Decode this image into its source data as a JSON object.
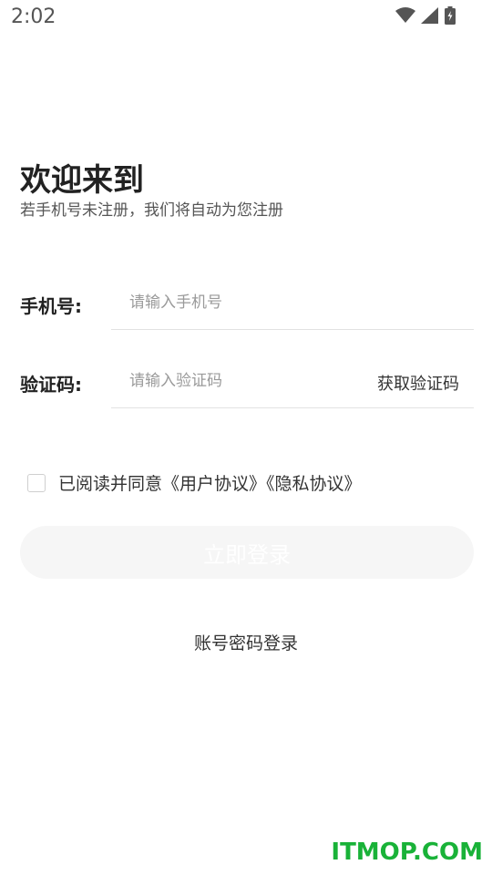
{
  "status_bar": {
    "time": "2:02"
  },
  "welcome": {
    "title": "欢迎来到",
    "subtitle": "若手机号未注册，我们将自动为您注册"
  },
  "phone": {
    "label": "手机号:",
    "placeholder": "请输入手机号",
    "value": ""
  },
  "code": {
    "label": "验证码:",
    "placeholder": "请输入验证码",
    "value": "",
    "get_code_label": "获取验证码"
  },
  "agreement": {
    "checked": false,
    "text": "已阅读并同意《用户协议》《隐私协议》"
  },
  "login_button": {
    "label": "立即登录"
  },
  "password_login": {
    "label": "账号密码登录"
  },
  "watermark": {
    "text": "ITMOP.COM"
  },
  "colors": {
    "watermark": "#19b238",
    "button_bg": "#f6f6f6",
    "divider": "#e2e2e2"
  }
}
